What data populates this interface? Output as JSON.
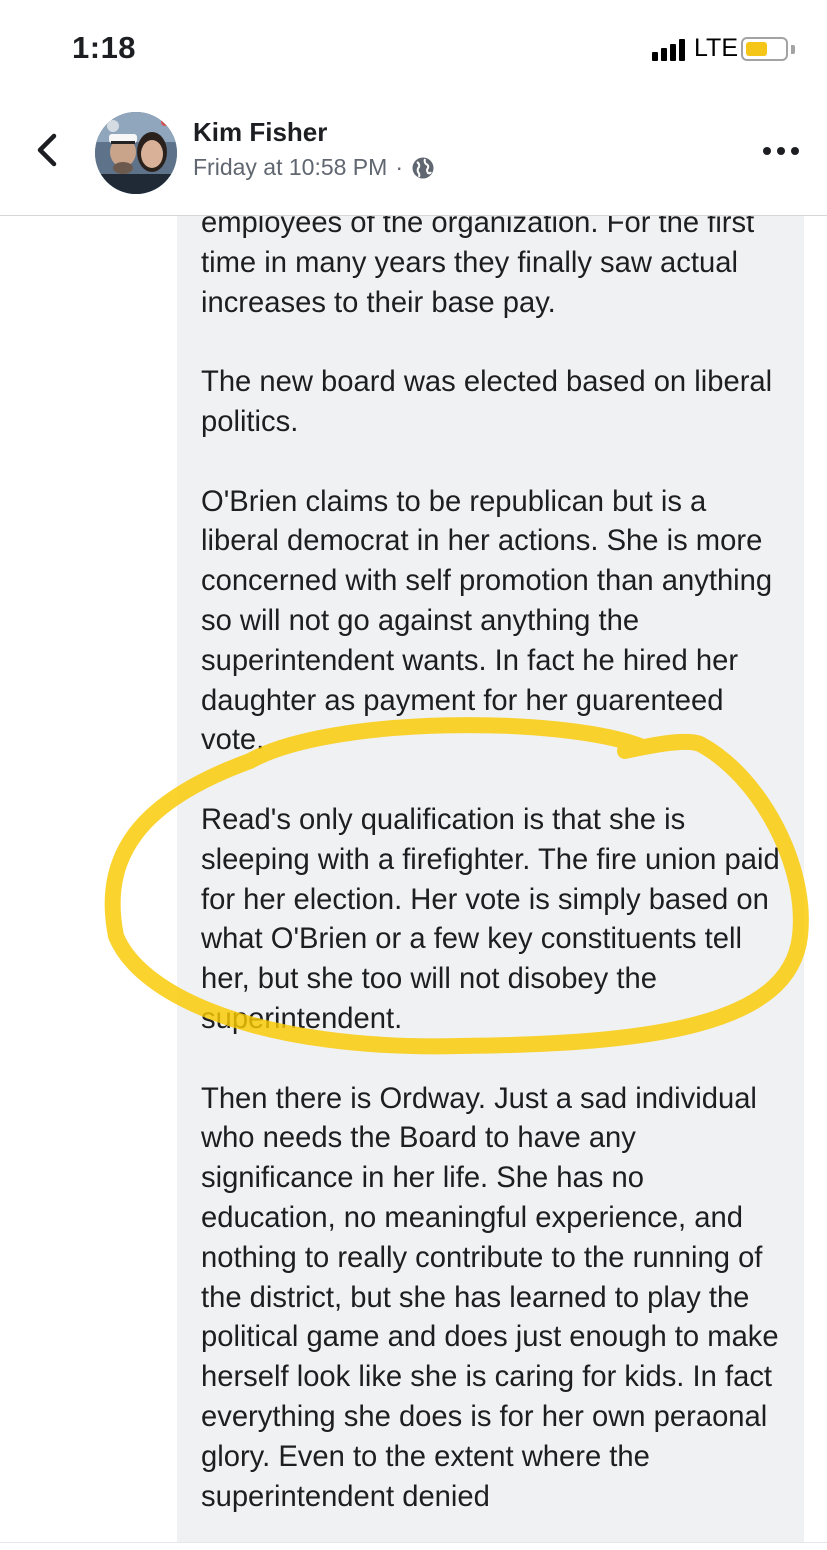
{
  "status_bar": {
    "time": "1:18",
    "network": "LTE",
    "battery_level": 0.55,
    "battery_color": "#f5c518"
  },
  "header": {
    "back_icon": "chevron-left-icon",
    "author": "Kim Fisher",
    "timestamp": "Friday at 10:58 PM",
    "separator": "·",
    "privacy_icon": "globe-icon",
    "more_icon": "ellipsis-icon"
  },
  "post": {
    "paragraphs": [
      "employees of the organization. For the first time in many years they finally saw actual increases to their base pay.",
      "The new board was elected based on liberal politics.",
      "O'Brien claims to be republican but is a liberal democrat in her actions. She is more concerned with self promotion than anything so will not go against anything the superintendent wants. In fact he hired her daughter as payment for her guarenteed vote.",
      "Read's only qualification is that she is sleeping with a firefighter. The fire union paid for her election. Her vote is simply based on what O'Brien or a few key constituents tell her, but she too will not disobey the superintendent.",
      "Then there is Ordway. Just a sad individual who needs the Board to have any significance in her life. She has no education, no meaningful experience, and nothing to really contribute to the running of the district, but she has learned to play the political game and does just enough to make herself look like she is caring for kids. In fact everything she does is for her own peraonal glory. Even to the extent where the superintendent denied"
    ],
    "highlight_color": "#f9c900"
  }
}
